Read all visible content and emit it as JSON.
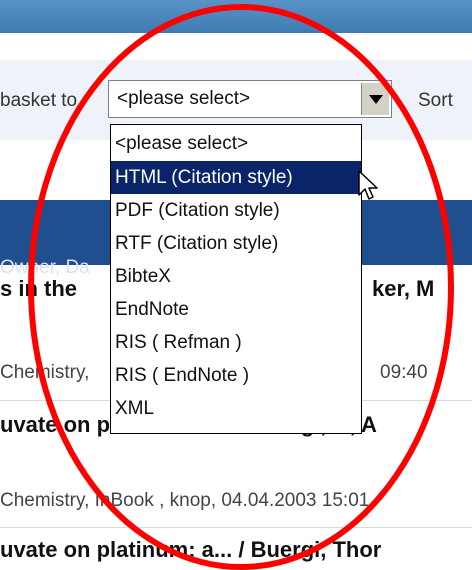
{
  "filter": {
    "basket_label": "basket to",
    "sort_label": "Sort"
  },
  "select": {
    "value": "<please select>",
    "options": [
      "<please select>",
      "HTML (Citation style)",
      "PDF (Citation style)",
      "RTF (Citation style)",
      "BibteX",
      "EndNote",
      "RIS ( Refman )",
      "RIS ( EndNote )",
      "XML"
    ],
    "highlighted_option": "HTML (Citation style)"
  },
  "band": {
    "owner_text": "Owner, Da"
  },
  "rows": [
    {
      "title_left": "s in the",
      "title_right": "ker, M",
      "meta_left": "Chemistry,",
      "meta_right": "09:40"
    },
    {
      "title_left": "uvate on platinum: a... / Buergi, T., A",
      "meta": "Chemistry, InBook , knop, 04.04.2003 15:01"
    },
    {
      "title": "uvate on platinum: a... / Buergi, Thor"
    }
  ],
  "colors": {
    "header": "#3e7bb2",
    "band": "#1f4f8e",
    "highlight": "#0a246a",
    "annotation": "#ff0000"
  }
}
